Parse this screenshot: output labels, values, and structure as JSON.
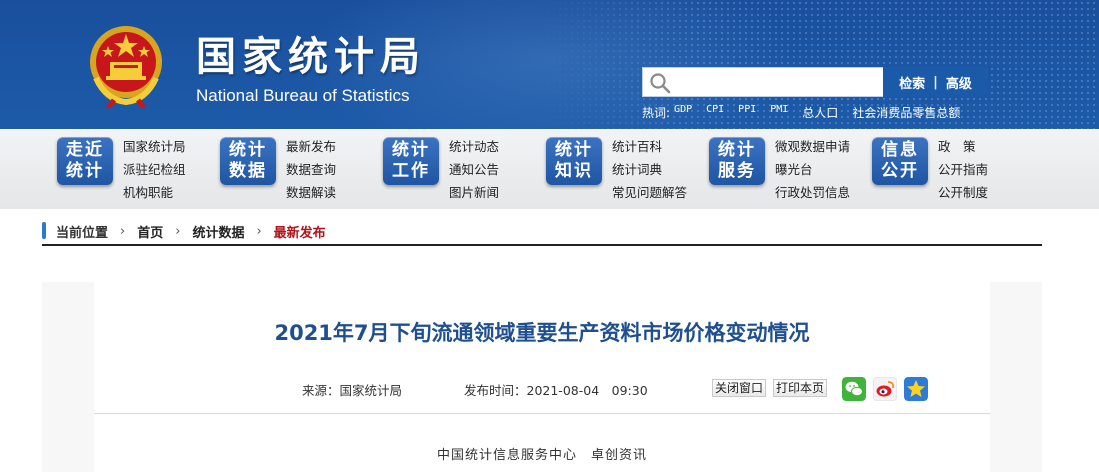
{
  "header": {
    "title_cn": "国家统计局",
    "title_en": "National Bureau of Statistics",
    "search": {
      "placeholder": "",
      "search_label": "检索",
      "advanced_label": "高级"
    },
    "hotwords_label": "热词:",
    "hotwords": [
      "GDP",
      "CPI",
      "PPI",
      "PMI",
      "总人口",
      "社会消费品零售总额"
    ]
  },
  "nav": [
    {
      "badge_line1": "走近",
      "badge_line2": "统计",
      "links": [
        "国家统计局",
        "派驻纪检组",
        "机构职能"
      ]
    },
    {
      "badge_line1": "统计",
      "badge_line2": "数据",
      "links": [
        "最新发布",
        "数据查询",
        "数据解读"
      ]
    },
    {
      "badge_line1": "统计",
      "badge_line2": "工作",
      "links": [
        "统计动态",
        "通知公告",
        "图片新闻"
      ]
    },
    {
      "badge_line1": "统计",
      "badge_line2": "知识",
      "links": [
        "统计百科",
        "统计词典",
        "常见问题解答"
      ]
    },
    {
      "badge_line1": "统计",
      "badge_line2": "服务",
      "links": [
        "微观数据申请",
        "曝光台",
        "行政处罚信息"
      ]
    },
    {
      "badge_line1": "信息",
      "badge_line2": "公开",
      "links": [
        "政　策",
        "公开指南",
        "公开制度"
      ]
    }
  ],
  "breadcrumb": {
    "label": "当前位置",
    "items": [
      "首页",
      "统计数据",
      "最新发布"
    ]
  },
  "article": {
    "title": "2021年7月下旬流通领域重要生产资料市场价格变动情况",
    "source": "来源：国家统计局",
    "published": "发布时间：2021-08-04　09:30",
    "close_label": "关闭窗口",
    "print_label": "打印本页",
    "source_line": "中国统计信息服务中心　卓创资讯"
  },
  "colors": {
    "header_blue": "#1b56a4",
    "title_blue": "#1f4f8e",
    "crumb_red": "#b0141d"
  }
}
